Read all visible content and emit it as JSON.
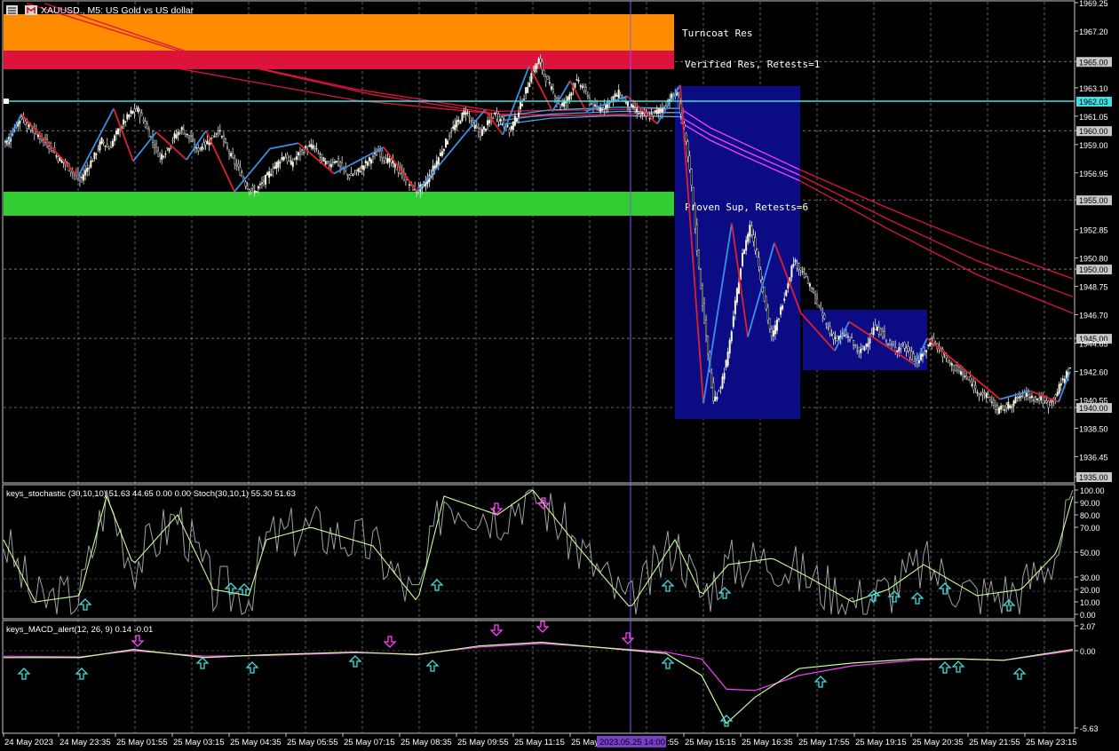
{
  "window": {
    "symbol_title": "XAUUSD., M5:  US Gold vs US dollar"
  },
  "colors": {
    "background": "#000000",
    "bull_candle": "#ffffd0",
    "bear_candle": "#ffffff",
    "zigzag_up": "#3a8fe6",
    "zigzag_down": "#e0202a",
    "turncoat_zone": "#ff8c00",
    "resistance_zone": "#dc143c",
    "support_zone": "#32cd32",
    "consolidation_box": "#0b0b84",
    "current_price_line": "#40e0e0",
    "ma_red": "#dc143c",
    "ma_magenta": "#ff40ff",
    "ma_cyan": "#40b0ff",
    "stoch_main": "#a0a0a0",
    "stoch_signal": "#c8ff9a",
    "macd_main": "#c8ff9a",
    "macd_signal": "#ff40ff",
    "arrow_up": "#40e0e0",
    "arrow_down": "#ff40ff",
    "grid": "#c8c8c8",
    "vline": "#8a4fff"
  },
  "zones": {
    "turncoat_label": "Turncoat Res",
    "verified_label": "Verified Res, Retests=1",
    "proven_label": "Proven Sup, Retests=6"
  },
  "price_axis": {
    "ticks": [
      "1969.25",
      "1967.20",
      "1965.00",
      "1963.10",
      "1961.05",
      "1960.00",
      "1959.00",
      "1956.95",
      "1955.00",
      "1952.85",
      "1950.80",
      "1950.00",
      "1948.75",
      "1946.70",
      "1945.00",
      "1944.65",
      "1942.60",
      "1940.55",
      "1940.00",
      "1938.50",
      "1936.45",
      "1935.00"
    ],
    "current_price": "1962.03"
  },
  "stoch_panel": {
    "title": "keys_stochastic (30,10,10) 51.63 44.65 0.00 0.00 Stoch(30,10,1) 55.30 51.63",
    "ticks": [
      "100.00",
      "90.00",
      "80.00",
      "70.00",
      "50.00",
      "30.00",
      "20.00",
      "10.00",
      "0.00"
    ]
  },
  "macd_panel": {
    "title": "keys_MACD_alert(12, 26, 9) 0.14 -0.01",
    "ticks": [
      "2.07",
      "0.00",
      "-5.63"
    ]
  },
  "time_axis": {
    "labels": [
      "24 May 2023",
      "24 May 23:35",
      "25 May 01:55",
      "25 May 03:15",
      "25 May 04:35",
      "25 May 05:55",
      "25 May 07:15",
      "25 May 08:35",
      "25 May 09:55",
      "25 May 11:15",
      "25 May",
      "25 May 15:15",
      "25 May 16:35",
      "25 May 17:55",
      "25 May 19:15",
      "25 May 20:35",
      "25 May 21:55",
      "25 May 23:15"
    ],
    "crosshair_label": "2023.05.25 14:00",
    "label_tail": ":55"
  },
  "chart_data": {
    "type": "candlestick",
    "symbol": "XAUUSD.",
    "timeframe": "M5",
    "ylim": [
      1935.0,
      1969.25
    ],
    "zones": [
      {
        "name": "Turncoat Res",
        "low": 1966.0,
        "high": 1969.0
      },
      {
        "name": "Verified Res, Retests=1",
        "low": 1964.6,
        "high": 1966.0
      },
      {
        "name": "Proven Sup, Retests=6",
        "low": 1954.1,
        "high": 1956.1
      }
    ],
    "close_series": [
      1959.2,
      1960.2,
      1961.0,
      1960.2,
      1959.8,
      1959.3,
      1958.8,
      1958.0,
      1957.6,
      1957.0,
      1956.4,
      1957.3,
      1958.2,
      1959.3,
      1958.7,
      1959.8,
      1960.6,
      1961.3,
      1961.5,
      1960.4,
      1959.2,
      1958.1,
      1958.7,
      1959.6,
      1960.1,
      1959.5,
      1958.6,
      1959.0,
      1959.4,
      1960.1,
      1958.9,
      1957.9,
      1957.0,
      1955.9,
      1955.6,
      1956.2,
      1956.9,
      1957.6,
      1958.2,
      1957.6,
      1958.3,
      1958.7,
      1958.9,
      1958.1,
      1957.5,
      1957.9,
      1957.3,
      1956.7,
      1957.0,
      1957.5,
      1958.0,
      1958.5,
      1957.9,
      1957.6,
      1957.0,
      1956.3,
      1955.7,
      1955.9,
      1956.7,
      1957.8,
      1958.9,
      1960.0,
      1960.7,
      1961.5,
      1960.4,
      1959.8,
      1960.5,
      1961.2,
      1960.6,
      1960.0,
      1961.1,
      1962.5,
      1964.1,
      1965.1,
      1963.8,
      1962.7,
      1961.8,
      1962.3,
      1963.6,
      1963.2,
      1962.1,
      1961.5,
      1961.8,
      1962.3,
      1962.7,
      1962.0,
      1961.6,
      1961.2,
      1961.0,
      1961.3,
      1961.6,
      1962.4,
      1962.6,
      1960.0,
      1956.0,
      1950.0,
      1945.0,
      1940.4,
      1941.6,
      1943.8,
      1947.5,
      1951.0,
      1953.1,
      1951.0,
      1947.8,
      1945.0,
      1946.6,
      1948.6,
      1950.6,
      1950.0,
      1949.0,
      1947.8,
      1946.6,
      1945.4,
      1944.9,
      1945.3,
      1944.8,
      1943.9,
      1944.6,
      1945.7,
      1945.5,
      1944.6,
      1944.2,
      1944.5,
      1943.8,
      1943.3,
      1944.0,
      1944.9,
      1944.2,
      1943.5,
      1942.9,
      1942.5,
      1942.0,
      1941.3,
      1941.0,
      1940.6,
      1939.8,
      1940.0,
      1940.3,
      1940.8,
      1941.0,
      1940.7,
      1940.6,
      1940.2,
      1940.9,
      1942.0,
      1942.9
    ],
    "stochastic": {
      "main": 55.3,
      "signal": 51.63,
      "params": "30,10,10"
    },
    "macd": {
      "main": 0.14,
      "signal": -0.01,
      "params": "12,26,9"
    }
  }
}
